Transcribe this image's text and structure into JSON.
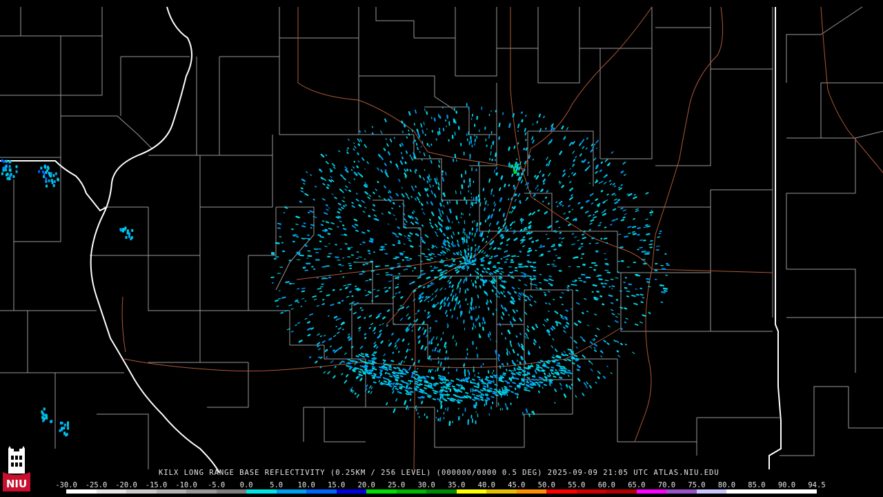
{
  "caption": "KILX LONG RANGE BASE REFLECTIVITY (0.25KM / 256 LEVEL) (000000/0000 0.5 DEG) 2025-09-09 21:05 UTC  ATLAS.NIU.EDU",
  "logo_text": "NIU",
  "scale": {
    "labels": [
      "-30.0",
      "-25.0",
      "-20.0",
      "-15.0",
      "-10.0",
      "-5.0",
      "0.0",
      "5.0",
      "10.0",
      "15.0",
      "20.0",
      "25.0",
      "30.0",
      "35.0",
      "40.0",
      "45.0",
      "50.0",
      "55.0",
      "60.0",
      "65.0",
      "70.0",
      "75.0",
      "80.0",
      "85.0",
      "90.0",
      "94.5"
    ],
    "colors": [
      "#ffffff",
      "#e6e6e6",
      "#cccccc",
      "#b3b3b3",
      "#999999",
      "#7f7f7f",
      "#00e5e5",
      "#00a0f0",
      "#0064ff",
      "#0000e0",
      "#00e000",
      "#00b800",
      "#008c00",
      "#ffff00",
      "#e6c000",
      "#ff9000",
      "#ff0000",
      "#d00000",
      "#b00000",
      "#ff00ff",
      "#9955c8",
      "#c8c8ff",
      "#ffffff",
      "#ffffff",
      "#ffffff"
    ]
  }
}
